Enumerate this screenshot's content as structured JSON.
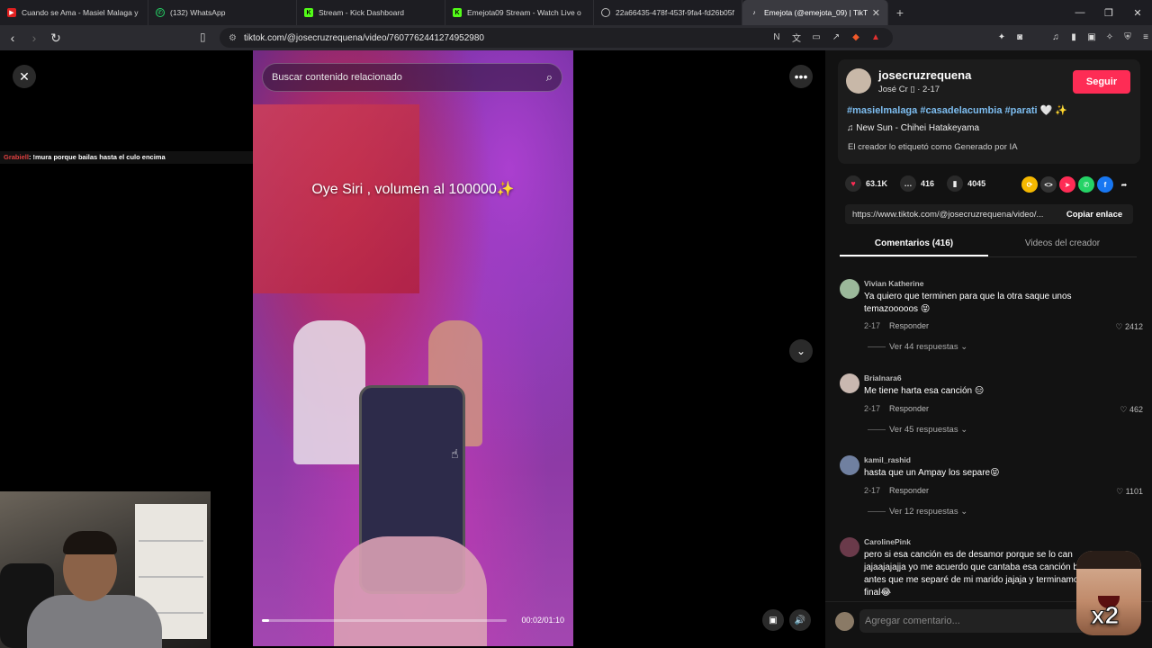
{
  "browser": {
    "tabs": [
      {
        "title": "Cuando se Ama - Masiel Malaga y su",
        "icon": "youtube-icon",
        "color": "#e02020"
      },
      {
        "title": "(132) WhatsApp",
        "icon": "whatsapp-icon",
        "color": "#25d366"
      },
      {
        "title": "Stream - Kick Dashboard",
        "icon": "kick-icon",
        "color": "#53fc18"
      },
      {
        "title": "Emejota09 Stream - Watch Live o",
        "icon": "kick-icon",
        "color": "#53fc18"
      },
      {
        "title": "22a66435-478f-453f-9fa4-fd26b05f",
        "icon": "globe-icon",
        "color": "#bbbbbb"
      },
      {
        "title": "Emejota (@emejota_09) | TikT",
        "icon": "tiktok-icon",
        "color": "#ffffff"
      }
    ],
    "new_tab": "+",
    "url": "tiktok.com/@josecruzrequena/video/7607762441274952980"
  },
  "chat_overlay": {
    "user": "Grabiell",
    "message": ": !mura porque bailas hasta el culo encima"
  },
  "video": {
    "search_placeholder": "Buscar contenido relacionado",
    "caption": "Oye Siri , volumen al 100000✨",
    "time": "00:02/01:10",
    "progress_fraction": 0.03
  },
  "panel": {
    "username": "josecruzrequena",
    "subline": "José Cr ▯ · 2-17",
    "follow_label": "Seguir",
    "hashtags": "#masielmalaga #casadelacumbia #parati",
    "hashtags_tail": " 🤍 ✨",
    "music": "New Sun - Chihei Hatakeyama",
    "ai_label": "El creador lo etiquetó como Generado por IA",
    "stats": {
      "likes": "63.1K",
      "comments": "416",
      "saves": "4045"
    },
    "link": "https://www.tiktok.com/@josecruzrequena/video/...",
    "copy_label": "Copiar enlace",
    "tabs": [
      "Comentarios (416)",
      "Videos del creador"
    ],
    "input_placeholder": "Agregar comentario...",
    "input_at": "@"
  },
  "comments": [
    {
      "name": "Vivian Katherine",
      "text": "Ya quiero que terminen para que la otra saque unos temazooooos 😝",
      "date": "2-17",
      "reply": "Responder",
      "likes": "2412",
      "replies": "Ver 44 respuestas"
    },
    {
      "name": "Brialnara6",
      "text": "Me tiene harta esa canción 😑",
      "date": "2-17",
      "reply": "Responder",
      "likes": "462",
      "replies": "Ver 45 respuestas"
    },
    {
      "name": "kamil_rashid",
      "text": "hasta que un Ampay los separe😝",
      "date": "2-17",
      "reply": "Responder",
      "likes": "1101",
      "replies": "Ver 12 respuestas"
    },
    {
      "name": "CarolinePink",
      "text": "pero si esa canción es de desamor porque se lo can jajaajajajja yo me acuerdo que cantaba esa canción balada antes que me separé de mi marido jajaja y terminamos al final😂",
      "date": "",
      "reply": "",
      "likes": "",
      "replies": ""
    }
  ],
  "overlay_badge": "x2"
}
